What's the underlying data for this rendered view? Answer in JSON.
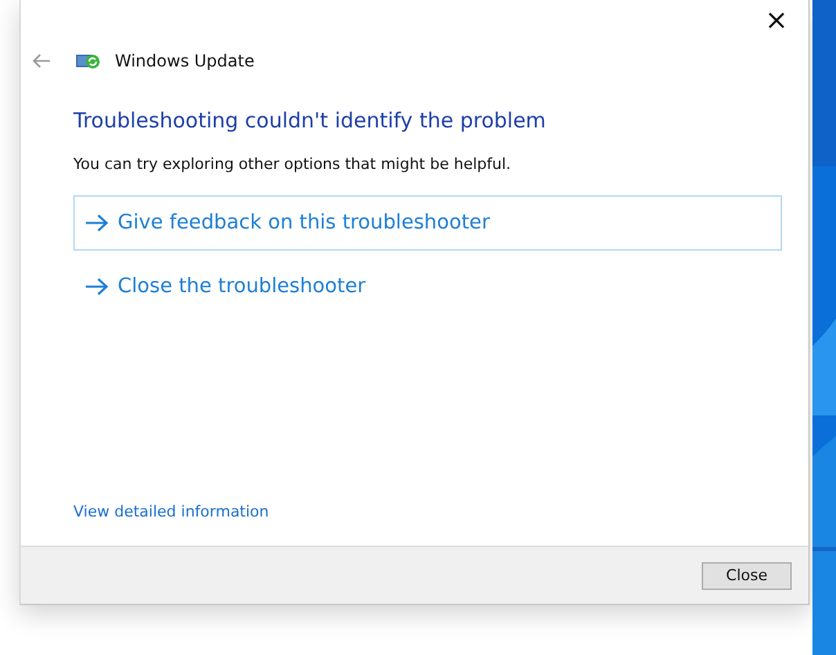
{
  "window": {
    "title": "Windows Update",
    "close_glyph": "×"
  },
  "heading": "Troubleshooting couldn't identify the problem",
  "description": "You can try exploring other options that might be helpful.",
  "options": [
    {
      "label": "Give feedback on this troubleshooter",
      "selected": true
    },
    {
      "label": "Close the troubleshooter",
      "selected": false
    }
  ],
  "details_link": "View detailed information",
  "buttons": [
    "Close"
  ]
}
